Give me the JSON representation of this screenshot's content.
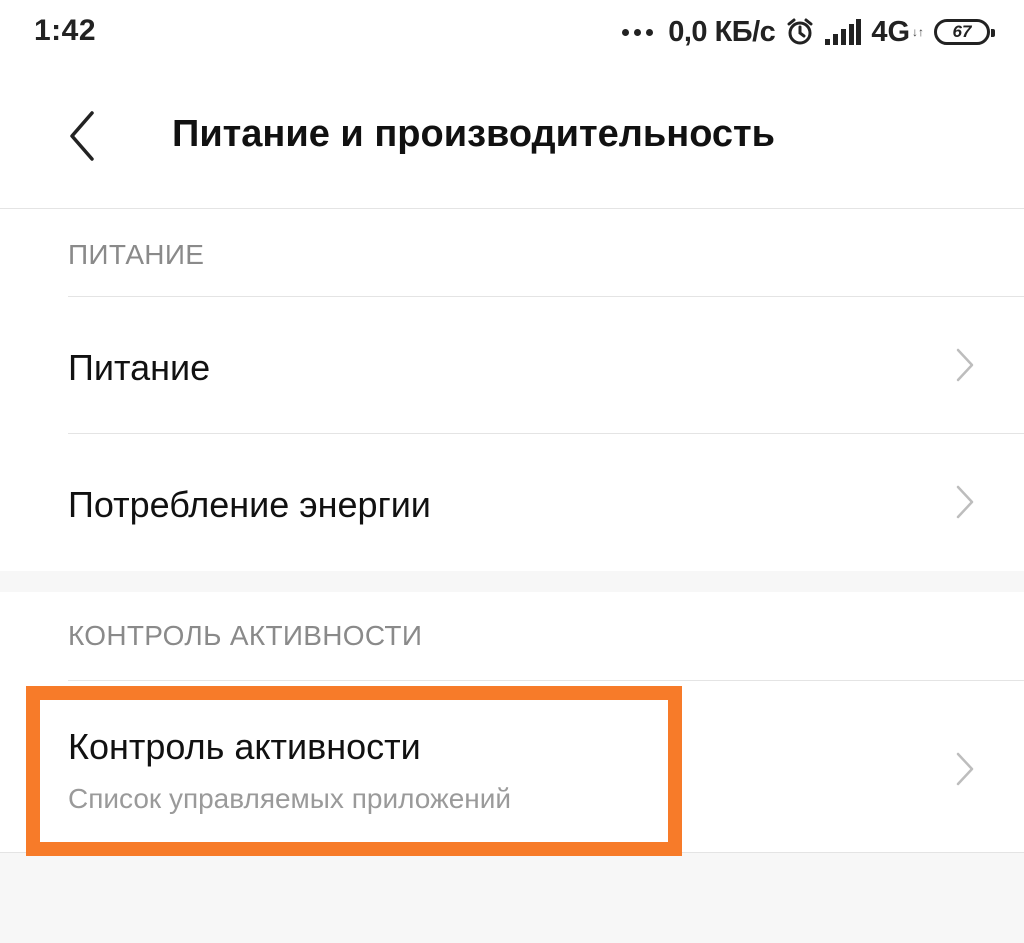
{
  "status_bar": {
    "time": "1:42",
    "net_speed": "0,0 КБ/с",
    "network_type": "4G",
    "battery_level": "67",
    "icons": [
      "more-dots-icon",
      "alarm-icon",
      "signal-icon",
      "battery-icon"
    ]
  },
  "header": {
    "back_icon": "chevron-left-icon",
    "title": "Питание и производительность"
  },
  "sections": {
    "power": {
      "header": "ПИТАНИЕ",
      "items": [
        {
          "title": "Питание"
        },
        {
          "title": "Потребление энергии"
        }
      ]
    },
    "activity": {
      "header": "КОНТРОЛЬ АКТИВНОСТИ",
      "items": [
        {
          "title": "Контроль активности",
          "subtitle": "Список управляемых приложений"
        }
      ]
    }
  },
  "colors": {
    "highlight": "#f77b29",
    "background": "#f7f7f7",
    "section_header": "#8a8a8a"
  }
}
